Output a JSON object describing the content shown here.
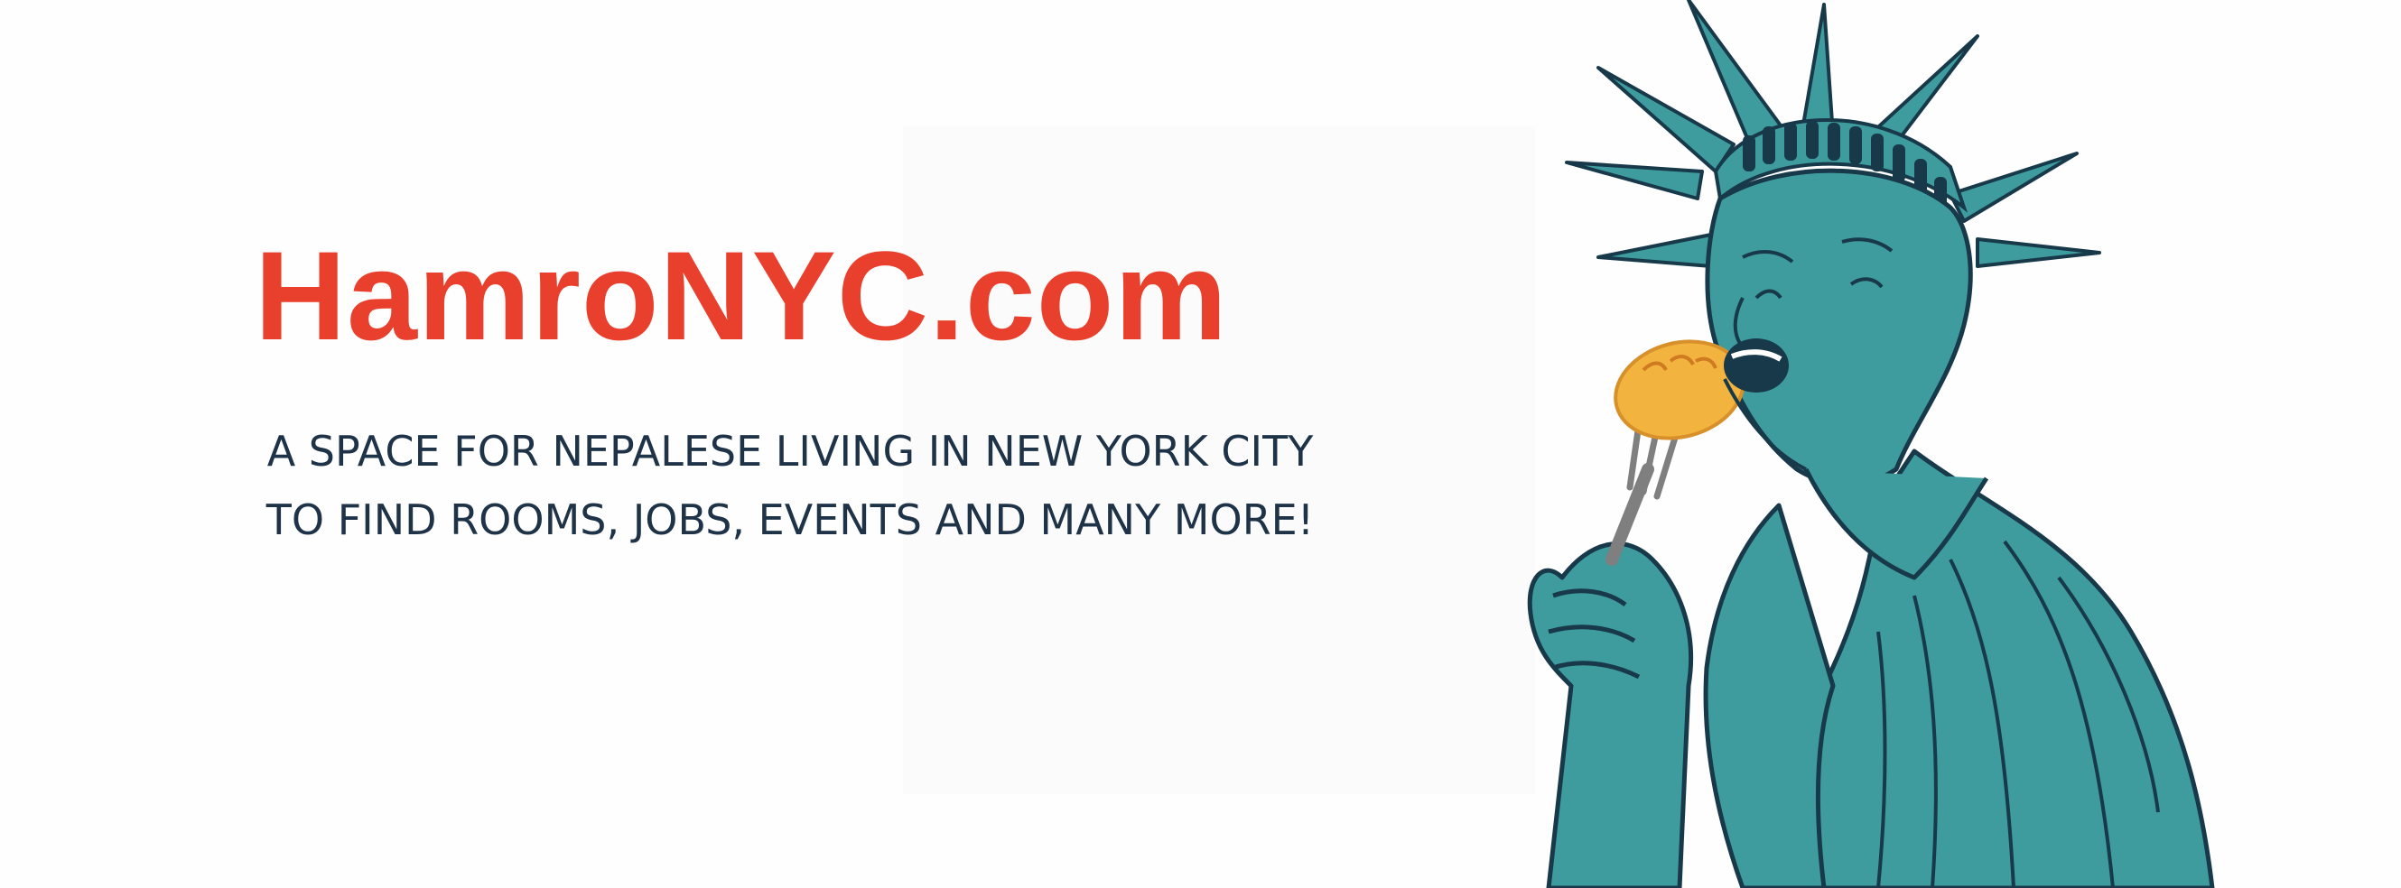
{
  "banner": {
    "title": "HamroNYC.com",
    "tagline_line1": "A SPACE FOR NEPALESE LIVING IN NEW YORK CITY",
    "tagline_line2": "TO FIND ROOMS, JOBS, EVENTS AND MANY MORE!"
  },
  "colors": {
    "title": "#e8402c",
    "tagline": "#1e3347",
    "statue_fill": "#3f9c9e",
    "statue_outline": "#17394a",
    "food": "#f2b43e",
    "background": "#fefefe"
  },
  "illustration": {
    "icon": "statue-of-liberty-eating-momo-icon"
  }
}
